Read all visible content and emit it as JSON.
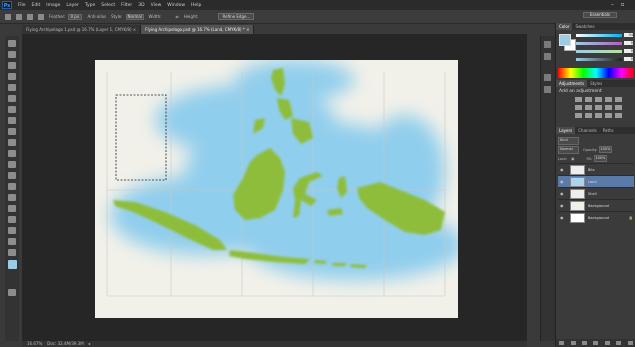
{
  "menu": {
    "logo": "Ps",
    "items": [
      "File",
      "Edit",
      "Image",
      "Layer",
      "Type",
      "Select",
      "Filter",
      "3D",
      "View",
      "Window",
      "Help"
    ],
    "workspace": "Essentials"
  },
  "options": {
    "feather_label": "Feather:",
    "feather_value": "0 px",
    "antialias_label": "Anti-alias",
    "style_label": "Style:",
    "style_value": "Normal",
    "width_label": "Width:",
    "height_label": "Height:",
    "refine_label": "Refine Edge..."
  },
  "tabs": [
    {
      "label": "Flying Archipelago 1.psd @ 16.7% (Layer 1, CMYK/8) ×"
    },
    {
      "label": "Flying Archipelago.psd @ 16.7% (Land, CMYK/8) * ×"
    }
  ],
  "status": {
    "zoom": "16.67%",
    "doc": "Doc: 32.4M/39.3M"
  },
  "color_panel": {
    "tabs": [
      "Color",
      "Swatches"
    ],
    "c": "34",
    "m": "0",
    "y": "0",
    "k": "0",
    "fg_color": "#9ccde6"
  },
  "adjust_panel": {
    "tabs": [
      "Adjustments",
      "Styles"
    ],
    "title": "Add an adjustment"
  },
  "layers_panel": {
    "tabs": [
      "Layers",
      "Channels",
      "Paths"
    ],
    "kind": "Kind",
    "blend": "Normal",
    "opacity_label": "Opacity:",
    "opacity": "100%",
    "lock_label": "Lock:",
    "fill_label": "Fill:",
    "fill": "100%",
    "layers": [
      {
        "name": "Bits"
      },
      {
        "name": "Land"
      },
      {
        "name": "Shell"
      },
      {
        "name": "Background"
      },
      {
        "name": "Background"
      }
    ]
  }
}
